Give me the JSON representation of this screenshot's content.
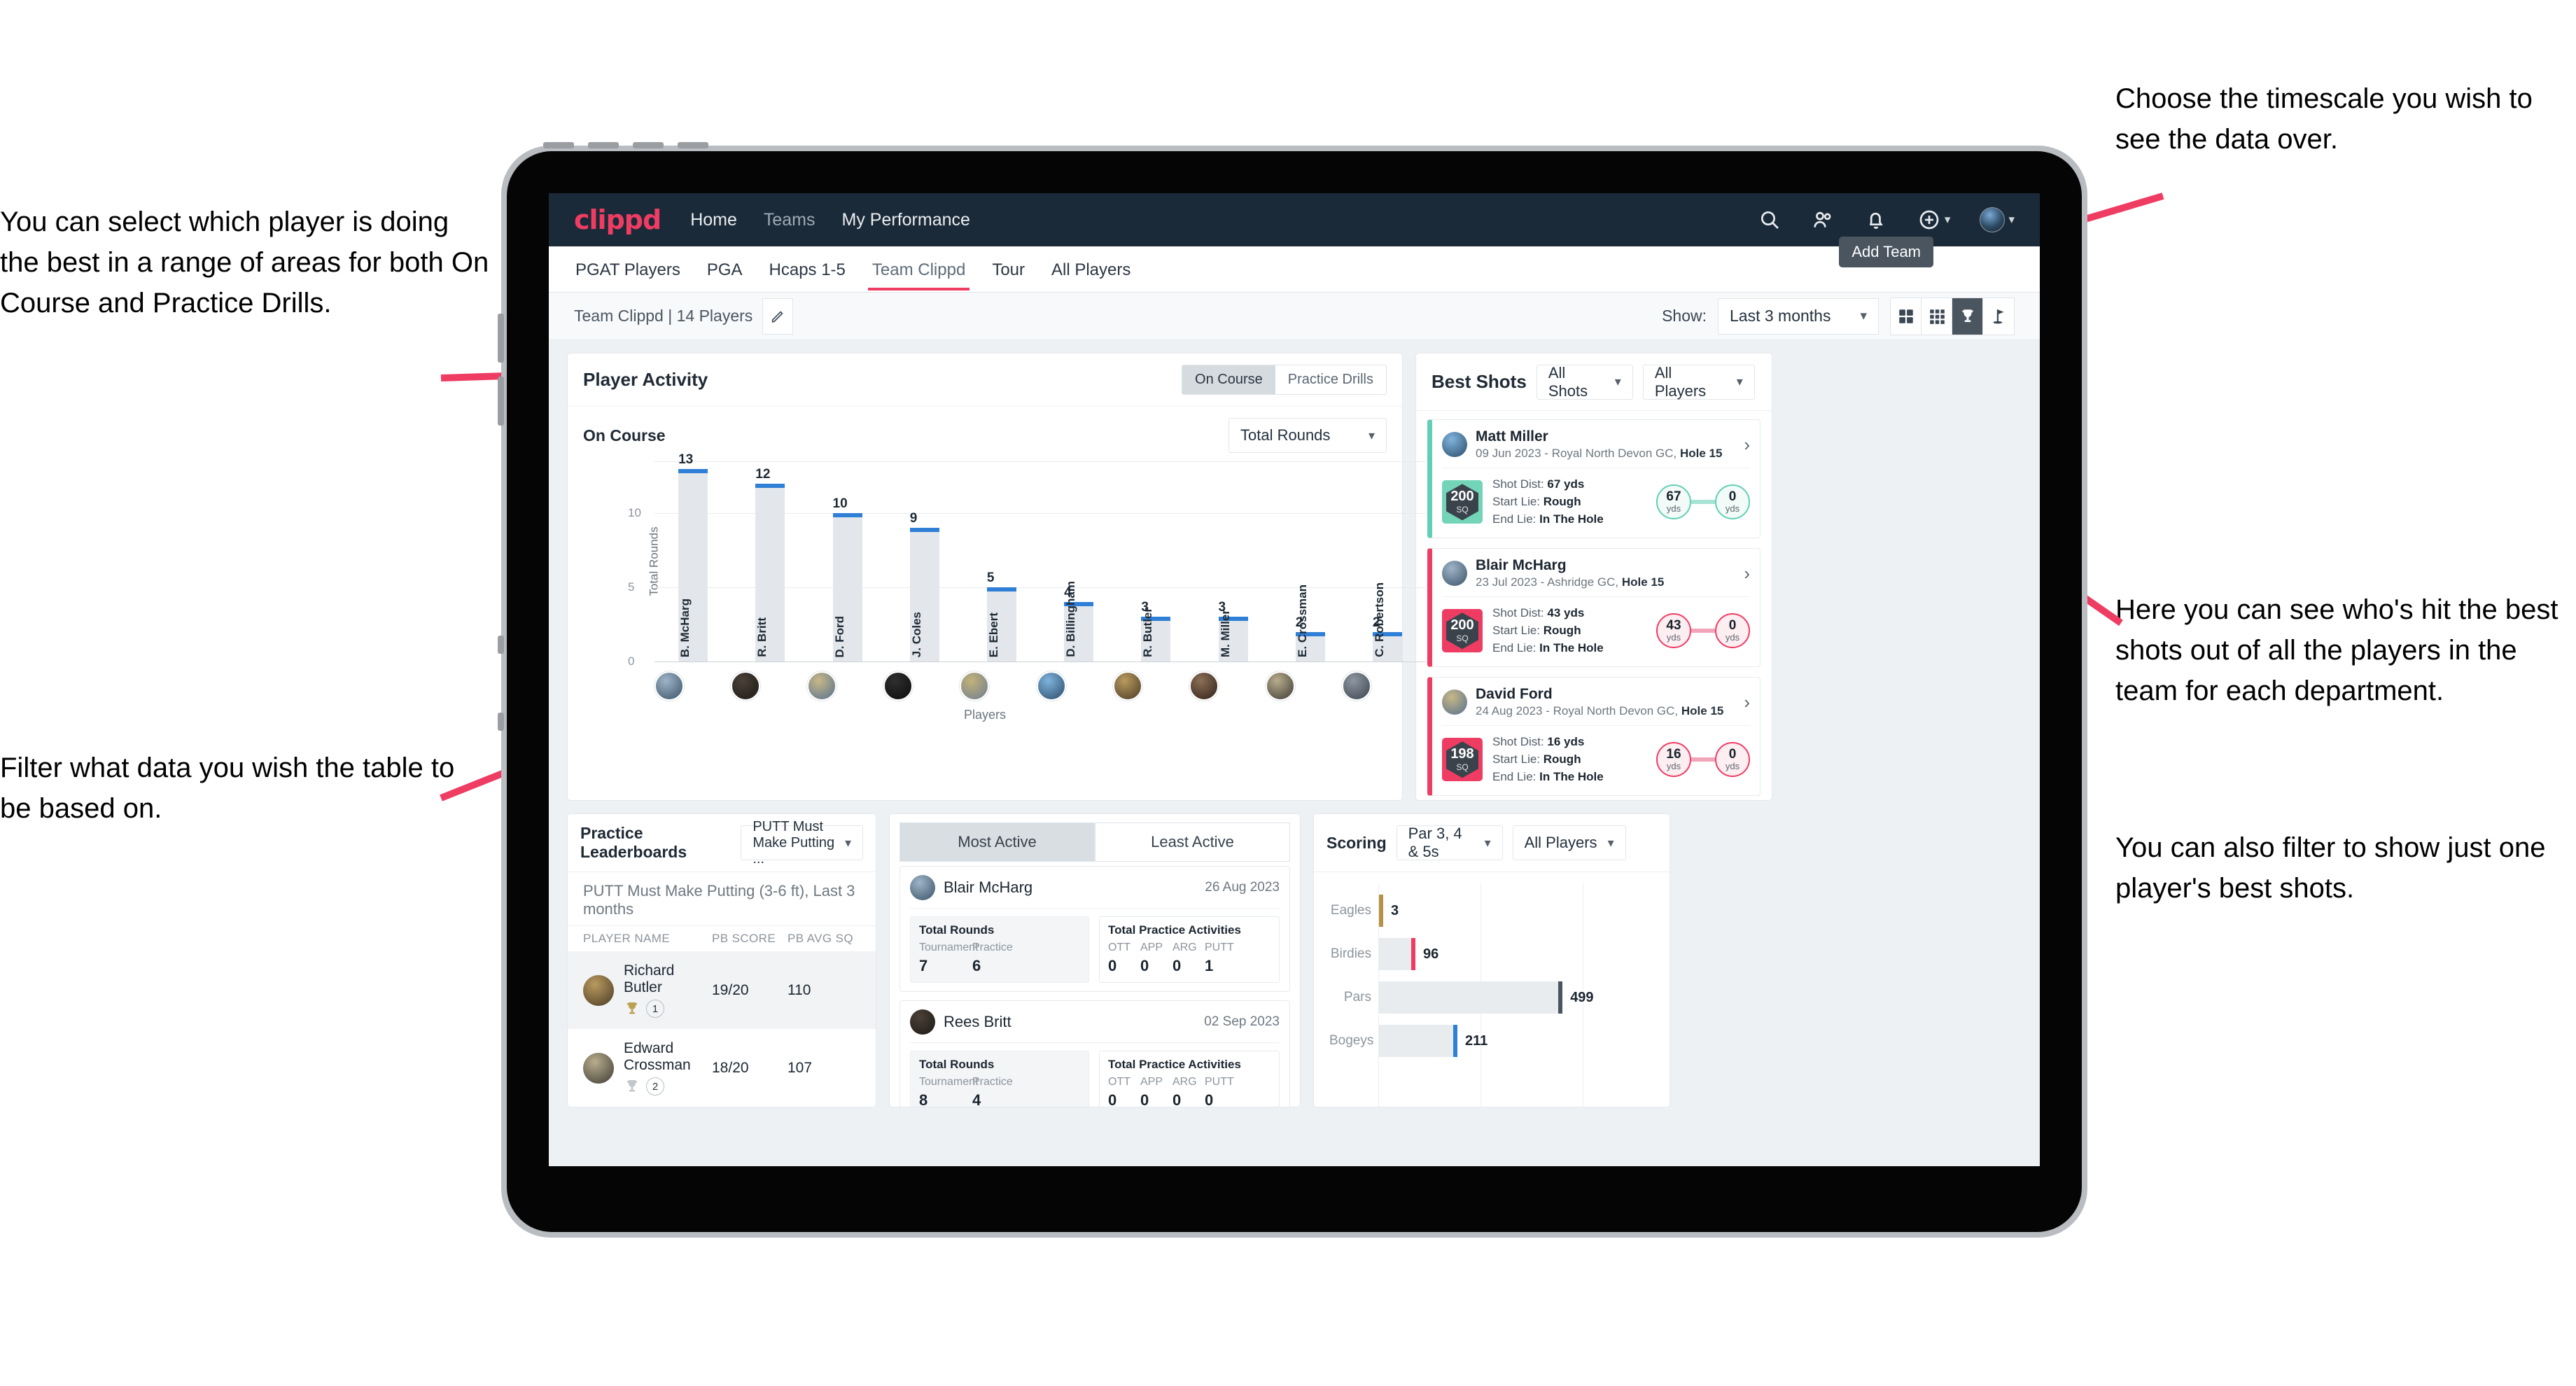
{
  "annotations": {
    "left_top": "You can select which player is doing the best in a range of areas for both On Course and Practice Drills.",
    "left_bottom": "Filter what data you wish the table to be based on.",
    "right_top": "Choose the timescale you wish to see the data over.",
    "right_mid": "Here you can see who's hit the best shots out of all the players in the team for each department.",
    "right_mid2": "You can also filter to show just one player's best shots."
  },
  "brand": {
    "name": "clippd",
    "accent": "#ef3c63",
    "navbg": "#1b2a38"
  },
  "topnav": {
    "links": [
      {
        "label": "Home"
      },
      {
        "label": "Teams"
      },
      {
        "label": "My Performance"
      }
    ],
    "icons": [
      "search-icon",
      "people-icon",
      "bell-icon",
      "plus-circle-icon",
      "avatar"
    ]
  },
  "tabs": [
    {
      "label": "PGAT Players",
      "active": false
    },
    {
      "label": "PGA",
      "active": false
    },
    {
      "label": "Hcaps 1-5",
      "active": false
    },
    {
      "label": "Team Clippd",
      "active": true
    },
    {
      "label": "Tour",
      "active": false
    },
    {
      "label": "All Players",
      "active": false
    }
  ],
  "tooltip": {
    "label": "Add Team"
  },
  "subbar": {
    "team_title": "Team Clippd",
    "team_count": "| 14 Players",
    "show_label": "Show:",
    "timescale": "Last 3 months",
    "view_buttons": [
      "grid-4-icon",
      "grid-9-icon",
      "trophy-icon",
      "flag-icon"
    ],
    "active_view": "trophy-icon"
  },
  "player_activity": {
    "title": "Player Activity",
    "segments": [
      {
        "label": "On Course",
        "active": true
      },
      {
        "label": "Practice Drills",
        "active": false
      }
    ],
    "sub_label": "On Course",
    "metric_select": "Total Rounds"
  },
  "best_shots": {
    "title": "Best Shots",
    "filter_shots": "All Shots",
    "filter_players": "All Players",
    "cards": [
      {
        "player": "Matt Miller",
        "meta_date": "09 Jun 2023 - Royal North Devon GC,",
        "meta_hole": "Hole 15",
        "quality": "200",
        "quality_unit": "SQ",
        "shot_dist_label": "Shot Dist:",
        "shot_dist": "67 yds",
        "start_lie_label": "Start Lie:",
        "start_lie": "Rough",
        "end_lie_label": "End Lie:",
        "end_lie": "In The Hole",
        "from_value": "67",
        "from_unit": "yds",
        "to_value": "0",
        "to_unit": "yds",
        "color": "teal"
      },
      {
        "player": "Blair McHarg",
        "meta_date": "23 Jul 2023 - Ashridge GC,",
        "meta_hole": "Hole 15",
        "quality": "200",
        "quality_unit": "SQ",
        "shot_dist_label": "Shot Dist:",
        "shot_dist": "43 yds",
        "start_lie_label": "Start Lie:",
        "start_lie": "Rough",
        "end_lie_label": "End Lie:",
        "end_lie": "In The Hole",
        "from_value": "43",
        "from_unit": "yds",
        "to_value": "0",
        "to_unit": "yds",
        "color": "pink"
      },
      {
        "player": "David Ford",
        "meta_date": "24 Aug 2023 - Royal North Devon GC,",
        "meta_hole": "Hole 15",
        "quality": "198",
        "quality_unit": "SQ",
        "shot_dist_label": "Shot Dist:",
        "shot_dist": "16 yds",
        "start_lie_label": "Start Lie:",
        "start_lie": "Rough",
        "end_lie_label": "End Lie:",
        "end_lie": "In The Hole",
        "from_value": "16",
        "from_unit": "yds",
        "to_value": "0",
        "to_unit": "yds",
        "color": "pink"
      }
    ]
  },
  "practice_leaderboards": {
    "title": "Practice Leaderboards",
    "drill_select": "PUTT Must Make Putting ...",
    "subtitle_bold": "PUTT Must Make Putting (3-6 ft),",
    "subtitle_light": "Last 3 months",
    "columns": [
      "PLAYER NAME",
      "PB SCORE",
      "PB AVG SQ"
    ],
    "rows": [
      {
        "name": "Richard Butler",
        "rank": "1",
        "trophy": "gold",
        "pb_score": "19/20",
        "pb_avg_sq": "110"
      },
      {
        "name": "Edward Crossman",
        "rank": "2",
        "trophy": "silver",
        "pb_score": "18/20",
        "pb_avg_sq": "107"
      }
    ]
  },
  "activity_panel": {
    "tabs": [
      {
        "label": "Most Active",
        "active": true
      },
      {
        "label": "Least Active",
        "active": false
      }
    ],
    "rounds_title": "Total Rounds",
    "practice_title": "Total Practice Activities",
    "rounds_cols": [
      "Tournament",
      "Practice"
    ],
    "practice_cols": [
      "OTT",
      "APP",
      "ARG",
      "PUTT"
    ],
    "items": [
      {
        "name": "Blair McHarg",
        "date": "26 Aug 2023",
        "rounds": [
          "7",
          "6"
        ],
        "practice": [
          "0",
          "0",
          "0",
          "1"
        ]
      },
      {
        "name": "Rees Britt",
        "date": "02 Sep 2023",
        "rounds": [
          "8",
          "4"
        ],
        "practice": [
          "0",
          "0",
          "0",
          "0"
        ]
      }
    ]
  },
  "scoring": {
    "title": "Scoring",
    "filter_par": "Par 3, 4 & 5s",
    "filter_players": "All Players"
  },
  "chart_data": [
    {
      "type": "bar",
      "title": "Player Activity - On Course",
      "xlabel": "Players",
      "ylabel": "Total Rounds",
      "ylim": [
        0,
        13.5
      ],
      "yticks": [
        0,
        5,
        10
      ],
      "grid": true,
      "categories": [
        "B. McHarg",
        "R. Britt",
        "D. Ford",
        "J. Coles",
        "E. Ebert",
        "D. Billingham",
        "R. Butler",
        "M. Miller",
        "E. Crossman",
        "C. Robertson"
      ],
      "values": [
        13,
        12,
        10,
        9,
        5,
        4,
        3,
        3,
        2,
        2
      ],
      "bar_color": "#e3e6ea",
      "cap_color": "#2f7fd6"
    },
    {
      "type": "bar",
      "orientation": "horizontal",
      "title": "Scoring",
      "xlabel": "",
      "ylabel": "",
      "grid": true,
      "xlim": [
        0,
        560
      ],
      "categories": [
        "Eagles",
        "Birdies",
        "Pars",
        "Bogeys"
      ],
      "values": [
        3,
        96,
        499,
        211
      ],
      "cap_colors": [
        "#b79145",
        "#ef3c63",
        "#4a5560",
        "#2f7fd6"
      ],
      "bar_color": "#e9ecef"
    }
  ]
}
